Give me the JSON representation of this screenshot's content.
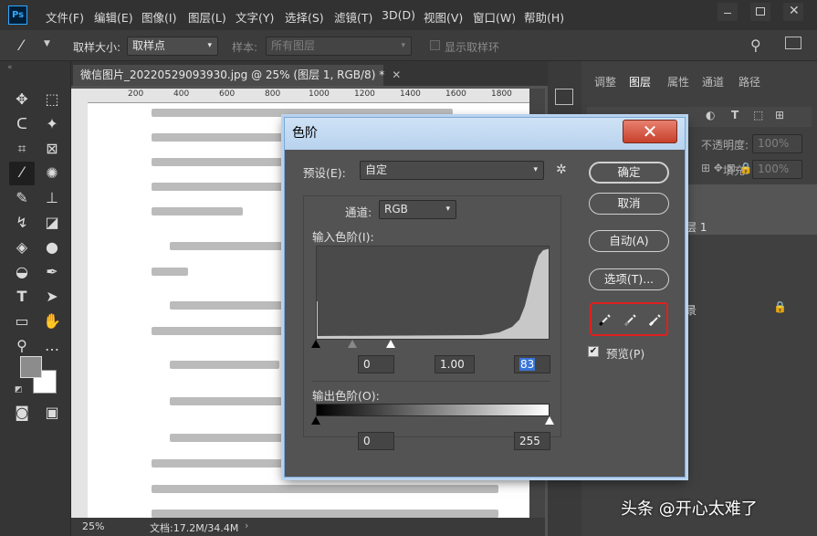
{
  "app_logo": "Ps",
  "menu": [
    "文件(F)",
    "编辑(E)",
    "图像(I)",
    "图层(L)",
    "文字(Y)",
    "选择(S)",
    "滤镜(T)",
    "3D(D)",
    "视图(V)",
    "窗口(W)",
    "帮助(H)"
  ],
  "options": {
    "sample_size_label": "取样大小:",
    "sample_size_value": "取样点",
    "sample_label": "样本:",
    "sample_value": "所有图层",
    "show_ring_label": "显示取样环"
  },
  "document": {
    "tab_title": "微信图片_20220529093930.jpg @ 25% (图层 1, RGB/8) *",
    "ruler_labels": [
      "200",
      "400",
      "600",
      "800",
      "1000",
      "1200",
      "1400",
      "1600",
      "1800"
    ],
    "zoom": "25%",
    "doc_size": "文档:17.2M/34.4M"
  },
  "panels": {
    "tabs": [
      "调整",
      "图层",
      "属性",
      "通道",
      "路径"
    ],
    "opacity_label": "不透明度:",
    "opacity_value": "100%",
    "fill_label": "填充:",
    "fill_value": "100%",
    "layer1_name": "层 1",
    "background_name": "景"
  },
  "dialog": {
    "title": "色阶",
    "preset_label": "预设(E):",
    "preset_value": "自定",
    "channel_label": "通道:",
    "channel_value": "RGB",
    "input_levels_label": "输入色阶(I):",
    "input_black": "0",
    "input_gamma": "1.00",
    "input_white": "83",
    "output_levels_label": "输出色阶(O):",
    "output_black": "0",
    "output_white": "255",
    "btn_ok": "确定",
    "btn_cancel": "取消",
    "btn_auto": "自动(A)",
    "btn_options": "选项(T)...",
    "preview_label": "预览(P)"
  },
  "watermark": "头条 @开心太难了",
  "colors": {
    "dialog_bg": "#535353",
    "title_bar": "#c4dbf2",
    "close_red": "#d0503a",
    "highlight_red": "#e02020"
  }
}
